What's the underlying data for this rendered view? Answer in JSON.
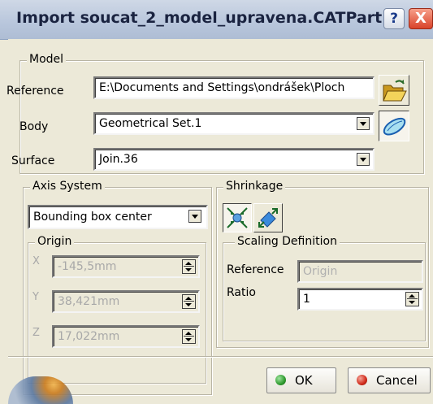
{
  "window": {
    "title": "Import soucat_2_model_upravena.CATPart",
    "help_glyph": "?",
    "close_glyph": "X"
  },
  "model": {
    "legend": "Model",
    "reference_label": "Reference",
    "reference_value": "E:\\Documents and Settings\\ondrášek\\Ploch",
    "body_label": "Body",
    "body_value": "Geometrical Set.1",
    "surface_label": "Surface",
    "surface_value": "Join.36"
  },
  "axis_system": {
    "legend": "Axis System",
    "mode_value": "Bounding box center",
    "origin_legend": "Origin",
    "x_label": "X",
    "x_value": "-145,5mm",
    "y_label": "Y",
    "y_value": "38,421mm",
    "z_label": "Z",
    "z_value": "17,022mm"
  },
  "shrinkage": {
    "legend": "Shrinkage",
    "scaling_legend": "Scaling Definition",
    "reference_label": "Reference",
    "reference_value": "Origin",
    "ratio_label": "Ratio",
    "ratio_value": "1"
  },
  "buttons": {
    "ok": "OK",
    "cancel": "Cancel"
  },
  "colors": {
    "ok_dot": "#2e9a2e",
    "cancel_dot": "#d02a1a",
    "folder": "#e8c040"
  },
  "icons": [
    "folder-open-icon",
    "surface-select-icon",
    "uniform-shrink-icon",
    "directional-shrink-icon"
  ]
}
